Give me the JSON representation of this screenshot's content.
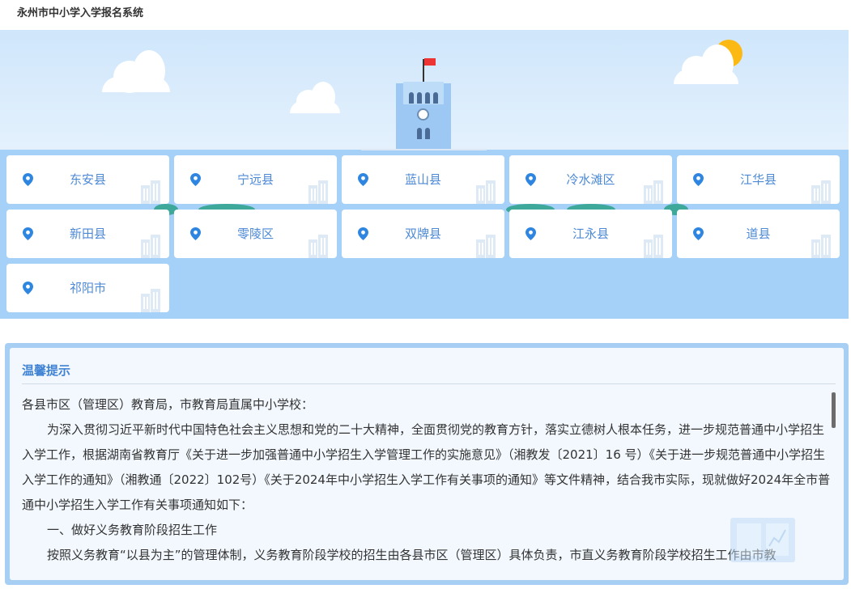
{
  "app": {
    "title": "永州市中小学入学报名系统"
  },
  "colors": {
    "accent": "#4d8ad6",
    "banner_bg": "#a5d0f7",
    "sun": "#fdb913",
    "flag": "#e33333"
  },
  "counties": [
    {
      "name": "东安县"
    },
    {
      "name": "宁远县"
    },
    {
      "name": "蓝山县"
    },
    {
      "name": "冷水滩区"
    },
    {
      "name": "江华县"
    },
    {
      "name": "新田县"
    },
    {
      "name": "零陵区"
    },
    {
      "name": "双牌县"
    },
    {
      "name": "江永县"
    },
    {
      "name": "道县"
    },
    {
      "name": "祁阳市"
    }
  ],
  "notice": {
    "title": "温馨提示",
    "paragraphs": [
      "各县市区（管理区）教育局，市教育局直属中小学校：",
      "为深入贯彻习近平新时代中国特色社会主义思想和党的二十大精神，全面贯彻党的教育方针，落实立德树人根本任务，进一步规范普通中小学招生入学工作，根据湖南省教育厅《关于进一步加强普通中小学招生入学管理工作的实施意见》（湘教发〔2021〕16 号）《关于进一步规范普通中小学招生入学工作的通知》（湘教通〔2022〕102号）《关于2024年中小学招生入学工作有关事项的通知》等文件精神，结合我市实际，现就做好2024年全市普通中小学招生入学工作有关事项通知如下：",
      "一、做好义务教育阶段招生工作",
      "按照义务教育“以县为主”的管理体制，义务教育阶段学校的招生由各县市区（管理区）具体负责，市直义务教育阶段学校招生工作由市教"
    ]
  }
}
